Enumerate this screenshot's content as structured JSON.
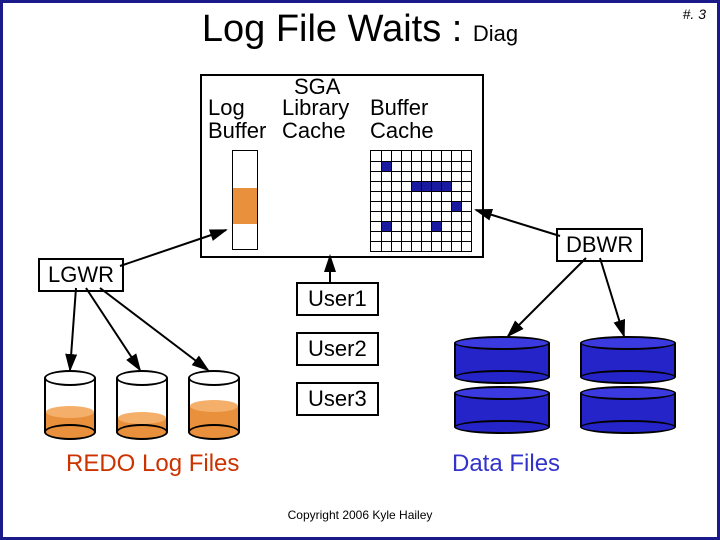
{
  "slide_number": "#. 3",
  "title_main": "Log File Waits : ",
  "title_sub": "Diag",
  "sga": {
    "title": "SGA",
    "log_buffer": "Log\nBuffer",
    "library_cache": "Library\nCache",
    "buffer_cache": "Buffer\nCache"
  },
  "processes": {
    "lgwr": "LGWR",
    "dbwr": "DBWR"
  },
  "users": {
    "u1": "User1",
    "u2": "User2",
    "u3": "User3"
  },
  "storage": {
    "redo": "REDO Log Files",
    "data": "Data Files"
  },
  "copyright": "Copyright 2006 Kyle Hailey",
  "colors": {
    "frame": "#1a1a8a",
    "redo_fill": "#e9903c",
    "blue_fill": "#2424c8"
  }
}
